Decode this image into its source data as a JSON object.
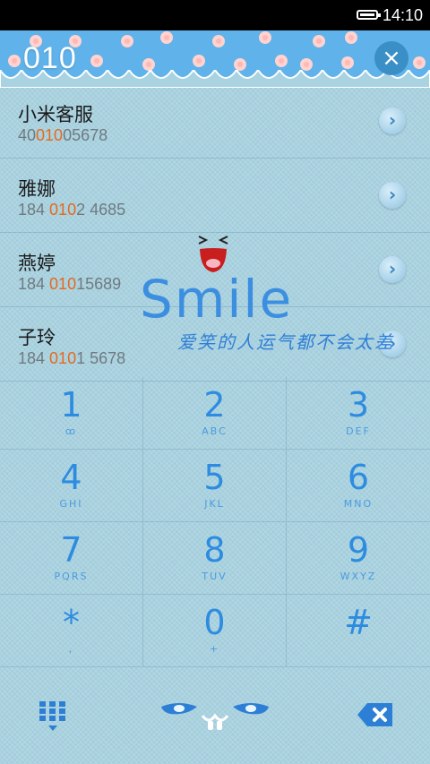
{
  "status": {
    "time": "14:10"
  },
  "header": {
    "number": "010",
    "close_label": "×"
  },
  "contacts": [
    {
      "name": "小米客服",
      "num_pre": "40",
      "num_hl": "010",
      "num_post": "05678"
    },
    {
      "name": "雅娜",
      "num_pre": "184 ",
      "num_hl": "010",
      "num_post": "2 4685"
    },
    {
      "name": "燕婷",
      "num_pre": "184 ",
      "num_hl": "010",
      "num_post": "15689"
    },
    {
      "name": "子玲",
      "num_pre": "184 ",
      "num_hl": "010",
      "num_post": "1 5678"
    }
  ],
  "smile": {
    "word": "Smile",
    "tagline": "爱笑的人运气都不会太差"
  },
  "keys": [
    {
      "d": "1",
      "l": "ꝏ"
    },
    {
      "d": "2",
      "l": "ABC"
    },
    {
      "d": "3",
      "l": "DEF"
    },
    {
      "d": "4",
      "l": "GHI"
    },
    {
      "d": "5",
      "l": "JKL"
    },
    {
      "d": "6",
      "l": "MNO"
    },
    {
      "d": "7",
      "l": "PQRS"
    },
    {
      "d": "8",
      "l": "TUV"
    },
    {
      "d": "9",
      "l": "WXYZ"
    },
    {
      "d": "*",
      "l": ","
    },
    {
      "d": "0",
      "l": "+"
    },
    {
      "d": "#",
      "l": ""
    }
  ],
  "icons": {
    "dialpad": "dialpad-icon",
    "cat": "cat-face-icon",
    "delete": "backspace-icon",
    "arrow": "chevron-right-icon"
  },
  "colors": {
    "accent": "#2d8ce0",
    "highlight": "#e46a1f",
    "header": "#5fb2ea"
  }
}
